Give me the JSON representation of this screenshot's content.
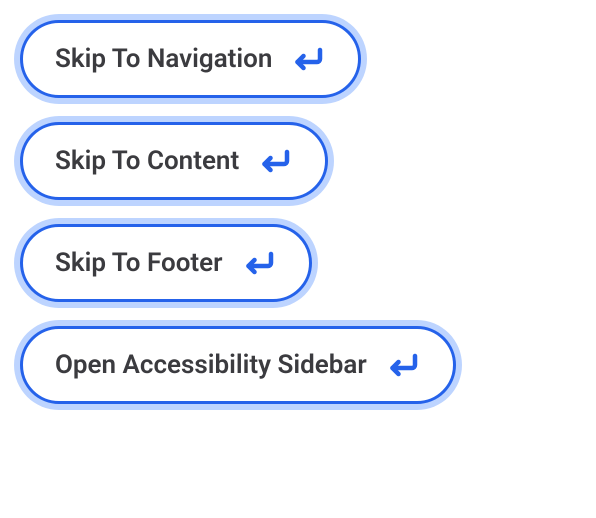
{
  "skip_links": {
    "items": [
      {
        "label": "Skip To Navigation"
      },
      {
        "label": "Skip To Content"
      },
      {
        "label": "Skip To Footer"
      },
      {
        "label": "Open Accessibility Sidebar"
      }
    ]
  },
  "colors": {
    "accent": "#2562ea",
    "focus_ring": "#bdd4ff",
    "text": "#3b3b3f"
  }
}
